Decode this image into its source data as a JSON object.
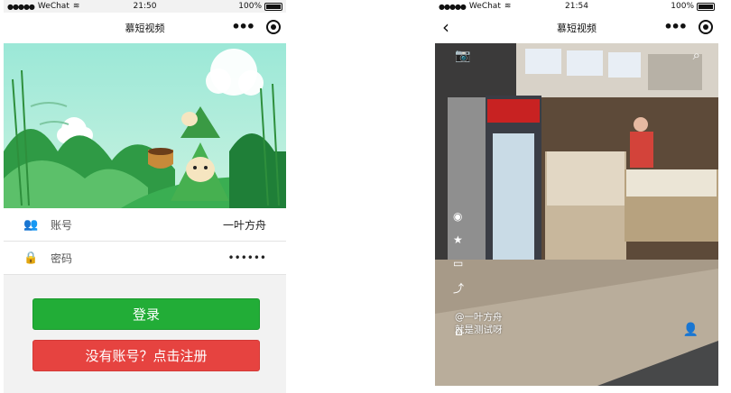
{
  "left": {
    "status": {
      "carrier": "WeChat",
      "time": "21:50",
      "battery": "100%"
    },
    "nav": {
      "title": "慕短视频"
    },
    "form": {
      "account_label": "账号",
      "account_value": "一叶方舟",
      "password_label": "密码",
      "password_value": "••••••"
    },
    "buttons": {
      "login": "登录",
      "register": "没有账号？点击注册"
    }
  },
  "right": {
    "status": {
      "carrier": "WeChat",
      "time": "21:54",
      "battery": "100%"
    },
    "nav": {
      "title": "慕短视频"
    },
    "video": {
      "author": "@一叶方舟",
      "description": "就是测试呀"
    }
  },
  "colors": {
    "login_green": "#22ad37",
    "register_red": "#e64340"
  }
}
